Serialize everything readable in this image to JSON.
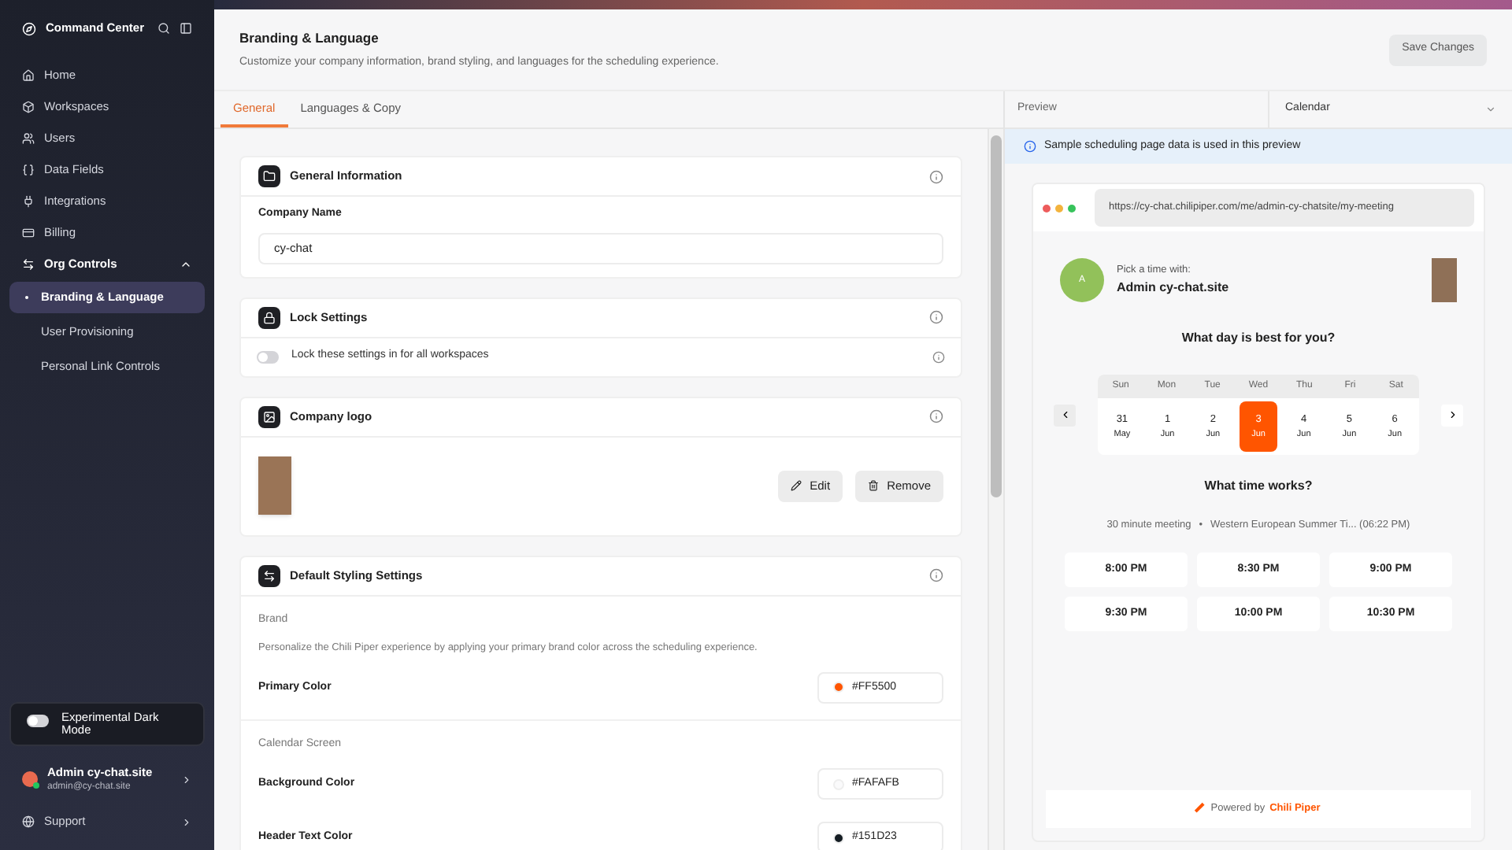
{
  "sidebar": {
    "title": "Command Center",
    "items": [
      {
        "label": "Home",
        "selected": false
      },
      {
        "label": "Workspaces",
        "selected": false
      },
      {
        "label": "Users",
        "selected": false
      },
      {
        "label": "Data Fields",
        "selected": false
      },
      {
        "label": "Integrations",
        "selected": false
      },
      {
        "label": "Billing",
        "selected": false
      },
      {
        "label": "Org Controls",
        "selected": false,
        "expanded": true,
        "children": [
          {
            "label": "Branding & Language",
            "selected": true
          },
          {
            "label": "User Provisioning",
            "selected": false
          },
          {
            "label": "Personal Link Controls",
            "selected": false
          }
        ]
      }
    ],
    "dark_mode": {
      "label": "Experimental Dark Mode",
      "on": false
    },
    "user": {
      "name": "Admin cy-chat.site",
      "email": "admin@cy-chat.site"
    },
    "support": "Support"
  },
  "header": {
    "title": "Branding & Language",
    "subtitle": "Customize your company information, brand styling, and languages for the scheduling experience.",
    "save_button": "Save Changes"
  },
  "tabs": [
    {
      "label": "General",
      "selected": true
    },
    {
      "label": "Languages & Copy",
      "selected": false
    }
  ],
  "general_information": {
    "title": "General Information",
    "field_label": "Company Name",
    "value": "cy-chat"
  },
  "lock_settings": {
    "title": "Lock Settings",
    "toggle_label": "Lock these settings in for all workspaces",
    "on": false
  },
  "company_logo": {
    "title": "Company logo",
    "edit": "Edit",
    "remove": "Remove"
  },
  "styling": {
    "title": "Default Styling Settings",
    "sections": [
      {
        "heading": "Brand",
        "description": "Personalize the Chili Piper experience by applying your primary brand color across the scheduling experience.",
        "colors": [
          {
            "label": "Primary Color",
            "value": "#FF5500",
            "color": "#ff5500"
          }
        ]
      },
      {
        "heading": "Calendar Screen",
        "colors": [
          {
            "label": "Background Color",
            "value": "#FAFAFB",
            "color": "#fafafb"
          },
          {
            "label": "Header Text Color",
            "value": "#151D23",
            "color": "#151d23"
          }
        ]
      }
    ]
  },
  "preview": {
    "label": "Preview",
    "view_select": "Calendar",
    "notice": "Sample scheduling page data is used in this preview",
    "url": "https://cy-chat.chilipiper.com/me/admin-cy-chatsite/my-meeting",
    "avatar_letter": "A",
    "pick_label": "Pick a time with:",
    "host": "Admin cy-chat.site",
    "day_question": "What day is best for you?",
    "days": [
      {
        "weekday": "Sun",
        "date": "31",
        "month": "May",
        "selected": false
      },
      {
        "weekday": "Mon",
        "date": "1",
        "month": "Jun",
        "selected": false
      },
      {
        "weekday": "Tue",
        "date": "2",
        "month": "Jun",
        "selected": false
      },
      {
        "weekday": "Wed",
        "date": "3",
        "month": "Jun",
        "selected": true
      },
      {
        "weekday": "Thu",
        "date": "4",
        "month": "Jun",
        "selected": false
      },
      {
        "weekday": "Fri",
        "date": "5",
        "month": "Jun",
        "selected": false
      },
      {
        "weekday": "Sat",
        "date": "6",
        "month": "Jun",
        "selected": false
      }
    ],
    "time_question": "What time works?",
    "meeting": "30 minute meeting",
    "separator": "•",
    "timezone": "Western European Summer Ti... (06:22 PM)",
    "times": [
      "8:00 PM",
      "8:30 PM",
      "9:00 PM",
      "9:30 PM",
      "10:00 PM",
      "10:30 PM"
    ],
    "powered_by": "Powered by",
    "brand": "Chili Piper"
  }
}
